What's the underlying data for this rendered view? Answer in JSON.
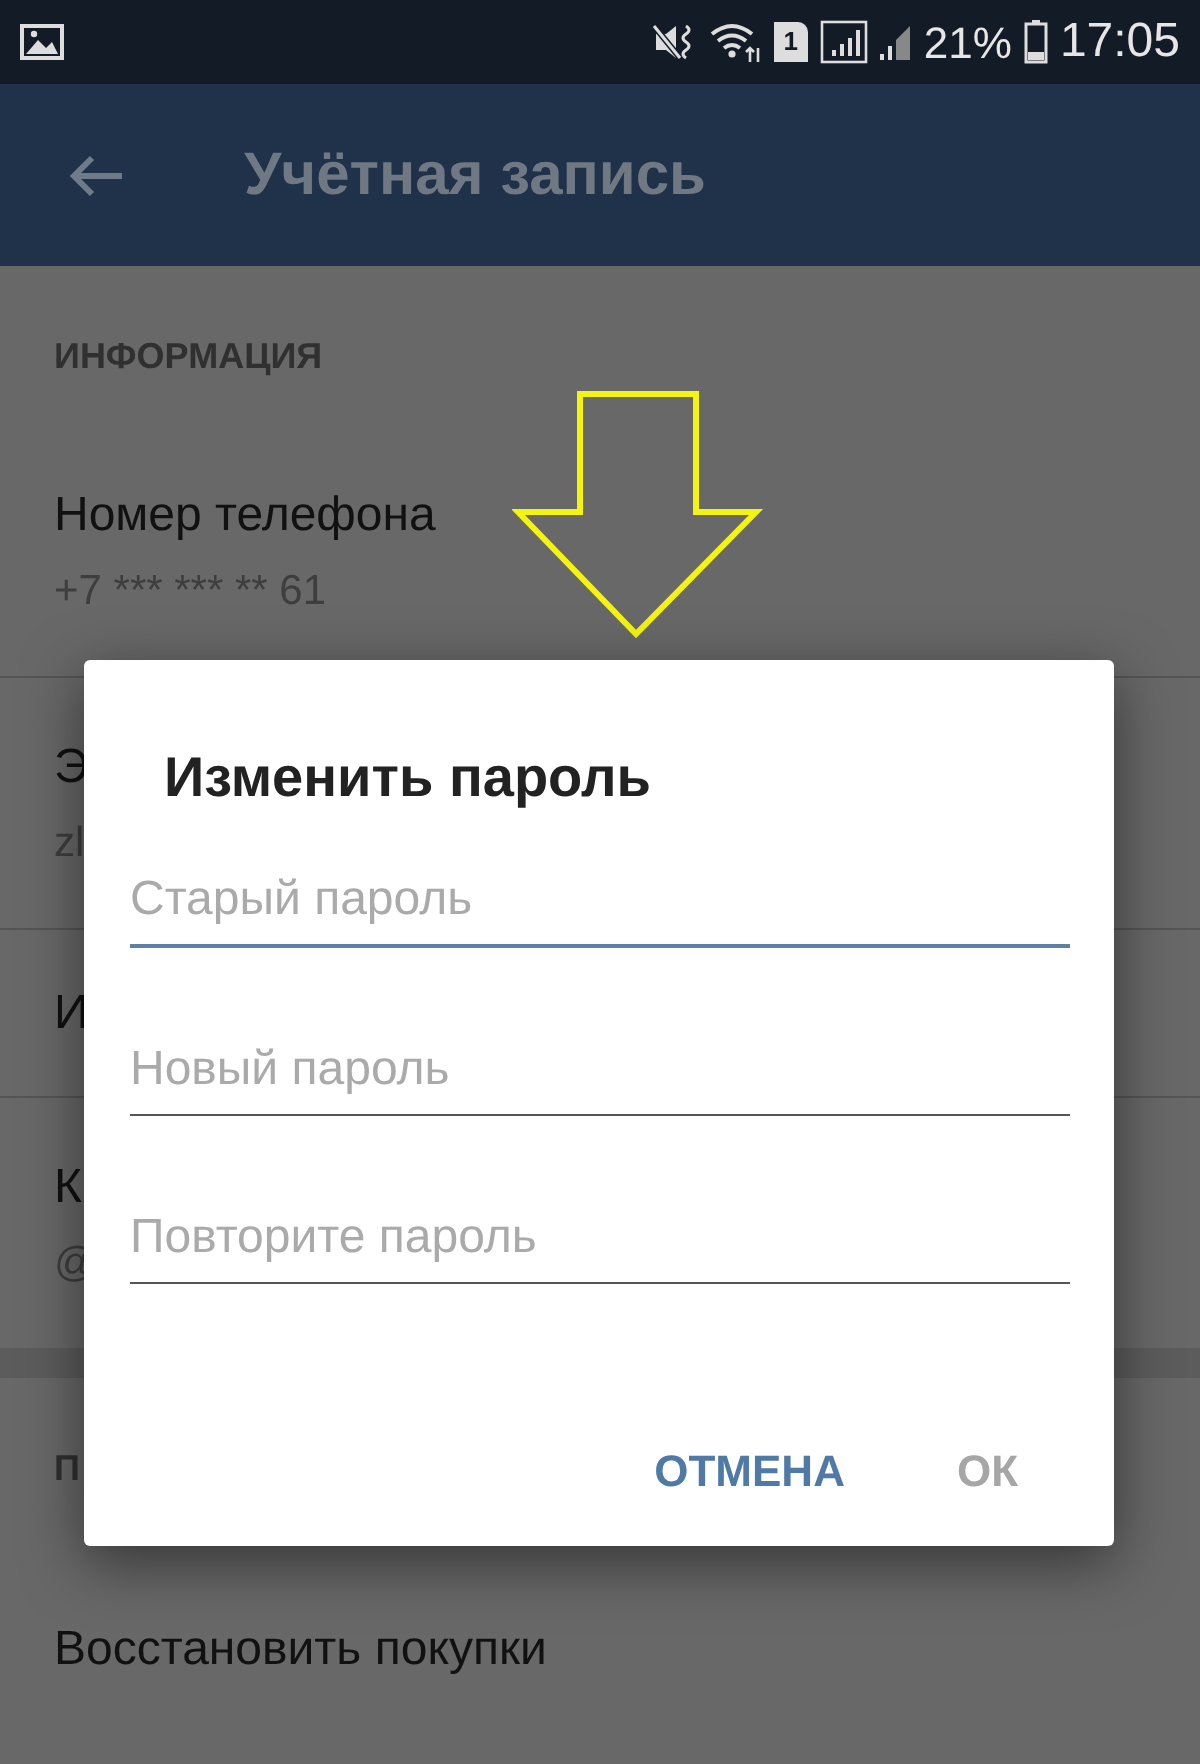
{
  "status_bar": {
    "sim_slot": "1",
    "battery": "21%",
    "time": "17:05"
  },
  "toolbar": {
    "title": "Учётная запись"
  },
  "sections": [
    {
      "header": "ИНФОРМАЦИЯ",
      "items": [
        {
          "title": "Номер телефона",
          "subtitle": "+7 *** *** ** 61"
        },
        {
          "title": "Э",
          "subtitle": "zl"
        },
        {
          "title": "И"
        },
        {
          "title": "К",
          "subtitle": "@"
        }
      ]
    },
    {
      "header": "П",
      "items": [
        {
          "title": "Восстановить покупки"
        }
      ]
    }
  ],
  "dialog": {
    "title": "Изменить пароль",
    "fields": [
      {
        "placeholder": "Старый пароль",
        "focused": true
      },
      {
        "placeholder": "Новый пароль",
        "focused": false
      },
      {
        "placeholder": "Повторите пароль",
        "focused": false
      }
    ],
    "buttons": [
      {
        "label": "ОТМЕНА",
        "disabled": false
      },
      {
        "label": "ОК",
        "disabled": true
      }
    ]
  }
}
